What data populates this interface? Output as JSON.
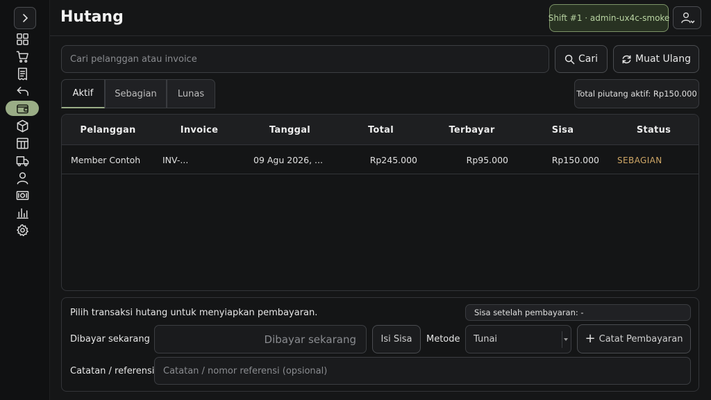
{
  "header": {
    "title": "Hutang",
    "shift_label": "Shift #1 · admin-ux4c-smoke"
  },
  "sidebar": {
    "items": [
      {
        "icon": "dashboard-icon"
      },
      {
        "icon": "cart-icon"
      },
      {
        "icon": "receipt-icon"
      },
      {
        "icon": "return-icon"
      },
      {
        "icon": "wallet-icon",
        "active": true
      },
      {
        "icon": "box-icon"
      },
      {
        "icon": "table-icon"
      },
      {
        "icon": "truck-icon"
      },
      {
        "icon": "user-icon"
      },
      {
        "icon": "cash-icon"
      },
      {
        "icon": "bar-chart-icon"
      },
      {
        "icon": "gear-icon"
      }
    ]
  },
  "search": {
    "placeholder": "Cari pelanggan atau invoice",
    "value": "",
    "search_label": "Cari",
    "reload_label": "Muat Ulang"
  },
  "tabs": [
    {
      "label": "Aktif",
      "active": true
    },
    {
      "label": "Sebagian",
      "active": false
    },
    {
      "label": "Lunas",
      "active": false
    }
  ],
  "total_active_label": "Total piutang aktif: Rp150.000",
  "table": {
    "columns": [
      "Pelanggan",
      "Invoice",
      "Tanggal",
      "Total",
      "Terbayar",
      "Sisa",
      "Status"
    ],
    "rows": [
      [
        "Member Contoh",
        "INV-...",
        "09 Agu 2026, ...",
        "Rp245.000",
        "Rp95.000",
        "Rp150.000",
        "SEBAGIAN"
      ]
    ]
  },
  "payment": {
    "hint": "Pilih transaksi hutang untuk menyiapkan pembayaran.",
    "remaining_label": "Sisa setelah pembayaran: -",
    "pay_now_label": "Dibayar sekarang",
    "pay_now_placeholder": "Dibayar sekarang",
    "fill_remaining_label": "Isi Sisa",
    "method_label": "Metode",
    "method_value": "Tunai",
    "record_label": "Catat Pembayaran",
    "note_label": "Catatan / referensi",
    "note_placeholder": "Catatan / nomor referensi (opsional)"
  },
  "colors": {
    "accent": "#9aad86",
    "status_partial": "#cfa766",
    "background": "#151617"
  }
}
